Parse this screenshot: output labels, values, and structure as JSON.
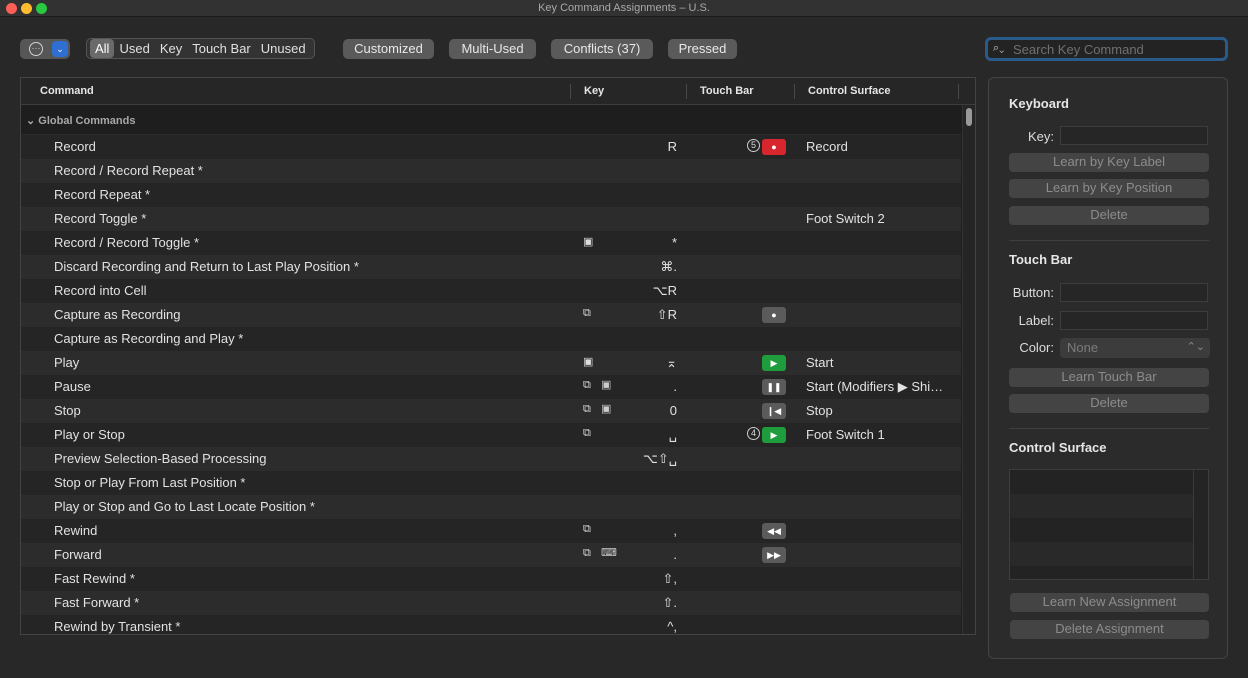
{
  "window": {
    "title": "Key Command Assignments – U.S."
  },
  "toolbar": {
    "view_icon": "ellipsis-circle-icon",
    "filter_tabs": [
      "All",
      "Used",
      "Key",
      "Touch Bar",
      "Unused"
    ],
    "customized_label": "Customized",
    "multiused_label": "Multi-Used",
    "conflicts_label": "Conflicts (37)",
    "pressed_label": "Pressed",
    "search_placeholder": "Search Key Command"
  },
  "table": {
    "columns": {
      "command": "Command",
      "key": "Key",
      "touch_bar": "Touch Bar",
      "control_surface": "Control Surface"
    },
    "group": "Global Commands",
    "rows": [
      {
        "command": "Record",
        "icons": "",
        "key": "R",
        "tb_num": "5",
        "tb": "record-red",
        "tb_glyph": "●",
        "cs": "Record"
      },
      {
        "command": "Record / Record Repeat *",
        "icons": "",
        "key": "",
        "tb_num": "",
        "tb": "",
        "tb_glyph": "",
        "cs": ""
      },
      {
        "command": "Record Repeat *",
        "icons": "",
        "key": "",
        "tb_num": "",
        "tb": "",
        "tb_glyph": "",
        "cs": ""
      },
      {
        "command": "Record Toggle *",
        "icons": "",
        "key": "",
        "tb_num": "",
        "tb": "",
        "tb_glyph": "",
        "cs": "Foot Switch 2"
      },
      {
        "command": "Record / Record Toggle *",
        "icons": "keypad",
        "key": "*",
        "tb_num": "",
        "tb": "",
        "tb_glyph": "",
        "cs": ""
      },
      {
        "command": "Discard Recording and Return to Last Play Position *",
        "icons": "",
        "key": "⌘.",
        "tb_num": "",
        "tb": "",
        "tb_glyph": "",
        "cs": ""
      },
      {
        "command": "Record into Cell",
        "icons": "",
        "key": "⌥R",
        "tb_num": "",
        "tb": "",
        "tb_glyph": "",
        "cs": ""
      },
      {
        "command": "Capture as Recording",
        "icons": "layers",
        "key": "⇧R",
        "tb_num": "",
        "tb": "record-gray",
        "tb_glyph": "●",
        "cs": ""
      },
      {
        "command": "Capture as Recording and Play *",
        "icons": "",
        "key": "",
        "tb_num": "",
        "tb": "",
        "tb_glyph": "",
        "cs": ""
      },
      {
        "command": "Play",
        "icons": "keypad",
        "key": "⌅",
        "tb_num": "",
        "tb": "play-green",
        "tb_glyph": "▶",
        "cs": "Start"
      },
      {
        "command": "Pause",
        "icons": "layers keypad",
        "key": ".",
        "tb_num": "",
        "tb": "pause-gray",
        "tb_glyph": "❚❚",
        "cs": "Start (Modifiers ▶ Shi…"
      },
      {
        "command": "Stop",
        "icons": "layers keypad",
        "key": "0",
        "tb_num": "",
        "tb": "stop-gray",
        "tb_glyph": "❙◀",
        "cs": "Stop"
      },
      {
        "command": "Play or Stop",
        "icons": "layers",
        "key": "␣",
        "tb_num": "4",
        "tb": "play-green",
        "tb_glyph": "▶",
        "cs": "Foot Switch 1"
      },
      {
        "command": "Preview Selection-Based Processing",
        "icons": "",
        "key": "⌥⇧␣",
        "tb_num": "",
        "tb": "",
        "tb_glyph": "",
        "cs": ""
      },
      {
        "command": "Stop or Play From Last Position *",
        "icons": "",
        "key": "",
        "tb_num": "",
        "tb": "",
        "tb_glyph": "",
        "cs": ""
      },
      {
        "command": "Play or Stop and Go to Last Locate Position *",
        "icons": "",
        "key": "",
        "tb_num": "",
        "tb": "",
        "tb_glyph": "",
        "cs": ""
      },
      {
        "command": "Rewind",
        "icons": "layers",
        "key": ",",
        "tb_num": "",
        "tb": "rewind-gray",
        "tb_glyph": "◀◀",
        "cs": ""
      },
      {
        "command": "Forward",
        "icons": "layers keyboard",
        "key": ".",
        "tb_num": "",
        "tb": "forward-gray",
        "tb_glyph": "▶▶",
        "cs": ""
      },
      {
        "command": "Fast Rewind *",
        "icons": "",
        "key": "⇧,",
        "tb_num": "",
        "tb": "",
        "tb_glyph": "",
        "cs": ""
      },
      {
        "command": "Fast Forward *",
        "icons": "",
        "key": "⇧.",
        "tb_num": "",
        "tb": "",
        "tb_glyph": "",
        "cs": ""
      },
      {
        "command": "Rewind by Transient *",
        "icons": "",
        "key": "^,",
        "tb_num": "",
        "tb": "",
        "tb_glyph": "",
        "cs": ""
      }
    ]
  },
  "panel": {
    "keyboard": {
      "heading": "Keyboard",
      "key_label": "Key:",
      "learn_key_label": "Learn by Key Label",
      "learn_key_position": "Learn by Key Position",
      "delete": "Delete"
    },
    "touch_bar": {
      "heading": "Touch Bar",
      "button_label": "Button:",
      "label_label": "Label:",
      "color_label": "Color:",
      "color_value": "None",
      "learn_touch_bar": "Learn Touch Bar",
      "delete": "Delete"
    },
    "control_surface": {
      "heading": "Control Surface",
      "learn_new": "Learn New Assignment",
      "delete_assignment": "Delete Assignment"
    }
  }
}
